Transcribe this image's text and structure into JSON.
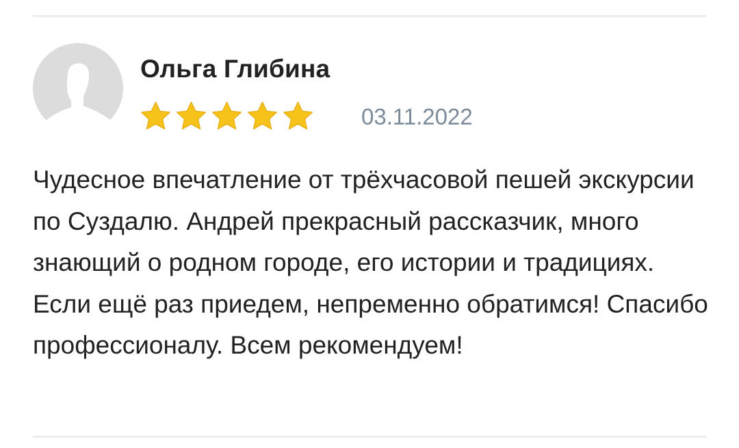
{
  "review": {
    "author": "Ольга Глибина",
    "rating": 5,
    "rating_max": 5,
    "date": "03.11.2022",
    "text": "Чудесное впечатление от трёхчасовой пешей экскурсии по Суздалю. Андрей прекрасный рассказчик, много знающий о родном городе, его истории и традициях. Если ещё раз приедем, непременно обратимся! Спасибо профессионалу. Всем рекомендуем!"
  },
  "colors": {
    "star_fill": "#f6c31b",
    "date_text": "#7b8a98",
    "avatar_bg": "#dcdcdc",
    "avatar_silhouette": "#ffffff",
    "divider": "#ececec",
    "text": "#222222"
  },
  "icons": {
    "avatar": "user-silhouette-icon",
    "star": "star-icon"
  }
}
